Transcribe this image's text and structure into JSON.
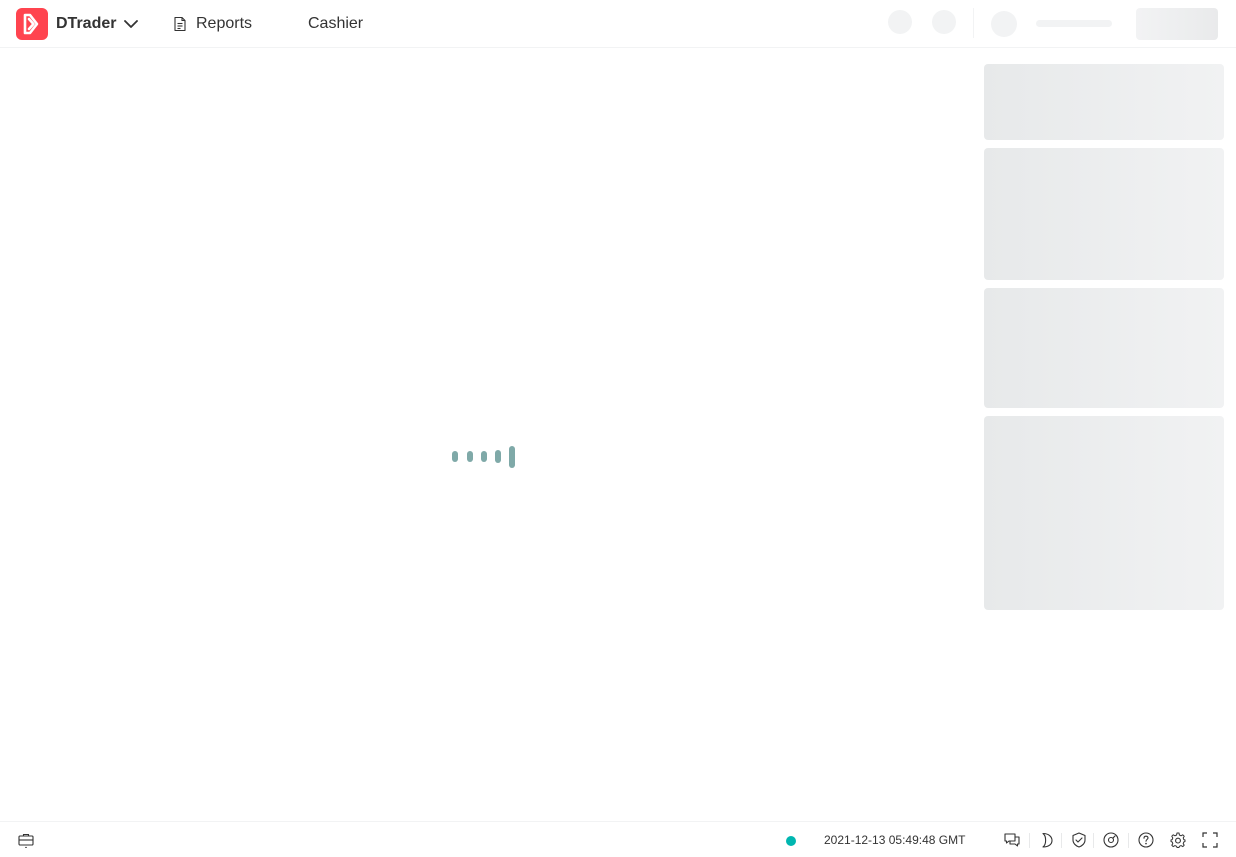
{
  "header": {
    "app_name": "DTrader",
    "nav": {
      "reports_label": "Reports",
      "cashier_label": "Cashier"
    }
  },
  "main": {
    "loader_icon": "loading-bars-icon",
    "side_panel_state": "loading-skeleton"
  },
  "footer": {
    "server_time": "2021-12-13 05:49:48 GMT",
    "status": "online"
  },
  "colors": {
    "brand": "#ff444f",
    "loader": "#7fa9a8",
    "status_online": "#00b6b0",
    "skeleton": "#f2f3f4"
  },
  "icons": {
    "logo": "deriv-logo-icon",
    "app_switcher": "chevron-down-icon",
    "reports": "reports-icon",
    "positions": "briefcase-icon",
    "footer": [
      "chat-icon",
      "theme-toggle-icon",
      "shield-icon",
      "gauge-icon",
      "help-icon",
      "gear-icon",
      "fullscreen-icon"
    ]
  }
}
